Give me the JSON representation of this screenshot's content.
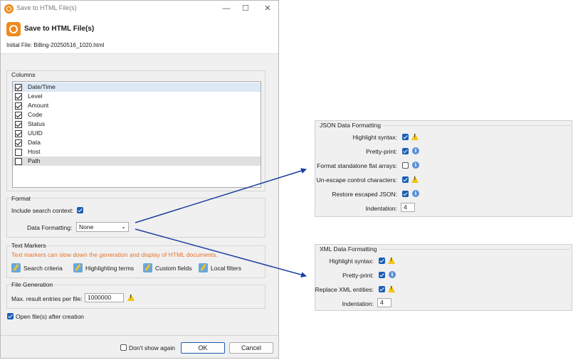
{
  "window": {
    "title": "Save to HTML File(s)",
    "controls": [
      "minimize-icon",
      "maximize-icon",
      "close-icon"
    ]
  },
  "header": {
    "title": "Save to HTML File(s)",
    "initial_file": "Initial File: Billing-20250516_1020.html"
  },
  "columns": {
    "label": "Columns",
    "items": [
      {
        "label": "Date/Time",
        "checked": true
      },
      {
        "label": "Level",
        "checked": true
      },
      {
        "label": "Amount",
        "checked": true
      },
      {
        "label": "Code",
        "checked": true
      },
      {
        "label": "Status",
        "checked": true
      },
      {
        "label": "UUID",
        "checked": true
      },
      {
        "label": "Data",
        "checked": true
      },
      {
        "label": "Host",
        "checked": false
      },
      {
        "label": "Path",
        "checked": false
      }
    ]
  },
  "format": {
    "label": "Format",
    "include_search_context": "Include search context:",
    "data_formatting_label": "Data Formatting:",
    "data_formatting_value": "None"
  },
  "text_markers": {
    "label": "Text Markers",
    "warning": "Text markers can slow down the generation and display of HTML documents.",
    "buttons": [
      "Search criteria",
      "Highlighting terms",
      "Custom fields",
      "Local filters"
    ]
  },
  "file_generation": {
    "label": "File Generation",
    "max_entries_label": "Max. result entries per file:",
    "max_entries_value": "1000000"
  },
  "open_after": "Open file(s) after creation",
  "footer": {
    "dont_show": "Don't show again",
    "ok": "OK",
    "cancel": "Cancel"
  },
  "json_panel": {
    "title": "JSON Data Formatting",
    "rows": [
      {
        "label": "Highlight syntax:",
        "checked": true,
        "icon": "warning-icon"
      },
      {
        "label": "Pretty-print:",
        "checked": true,
        "icon": "info-icon"
      },
      {
        "label": "Format standalone flat arrays:",
        "checked": false,
        "icon": "info-icon"
      },
      {
        "label": "Un-escape control characters:",
        "checked": true,
        "icon": "warning-icon"
      },
      {
        "label": "Restore escaped JSON:",
        "checked": true,
        "icon": "info-icon"
      }
    ],
    "indentation_label": "Indentation:",
    "indentation_value": "4"
  },
  "xml_panel": {
    "title": "XML Data Formatting",
    "rows": [
      {
        "label": "Highlight syntax:",
        "checked": true,
        "icon": "warning-icon"
      },
      {
        "label": "Pretty-print:",
        "checked": true,
        "icon": "info-icon"
      },
      {
        "label": "Replace XML entities:",
        "checked": true,
        "icon": "warning-icon"
      }
    ],
    "indentation_label": "Indentation:",
    "indentation_value": "4"
  },
  "colors": {
    "accent": "#1a5fb4",
    "warning_text": "#e8722a",
    "arrow": "#1a3fa0",
    "app_orange": "#ef8a1c"
  }
}
